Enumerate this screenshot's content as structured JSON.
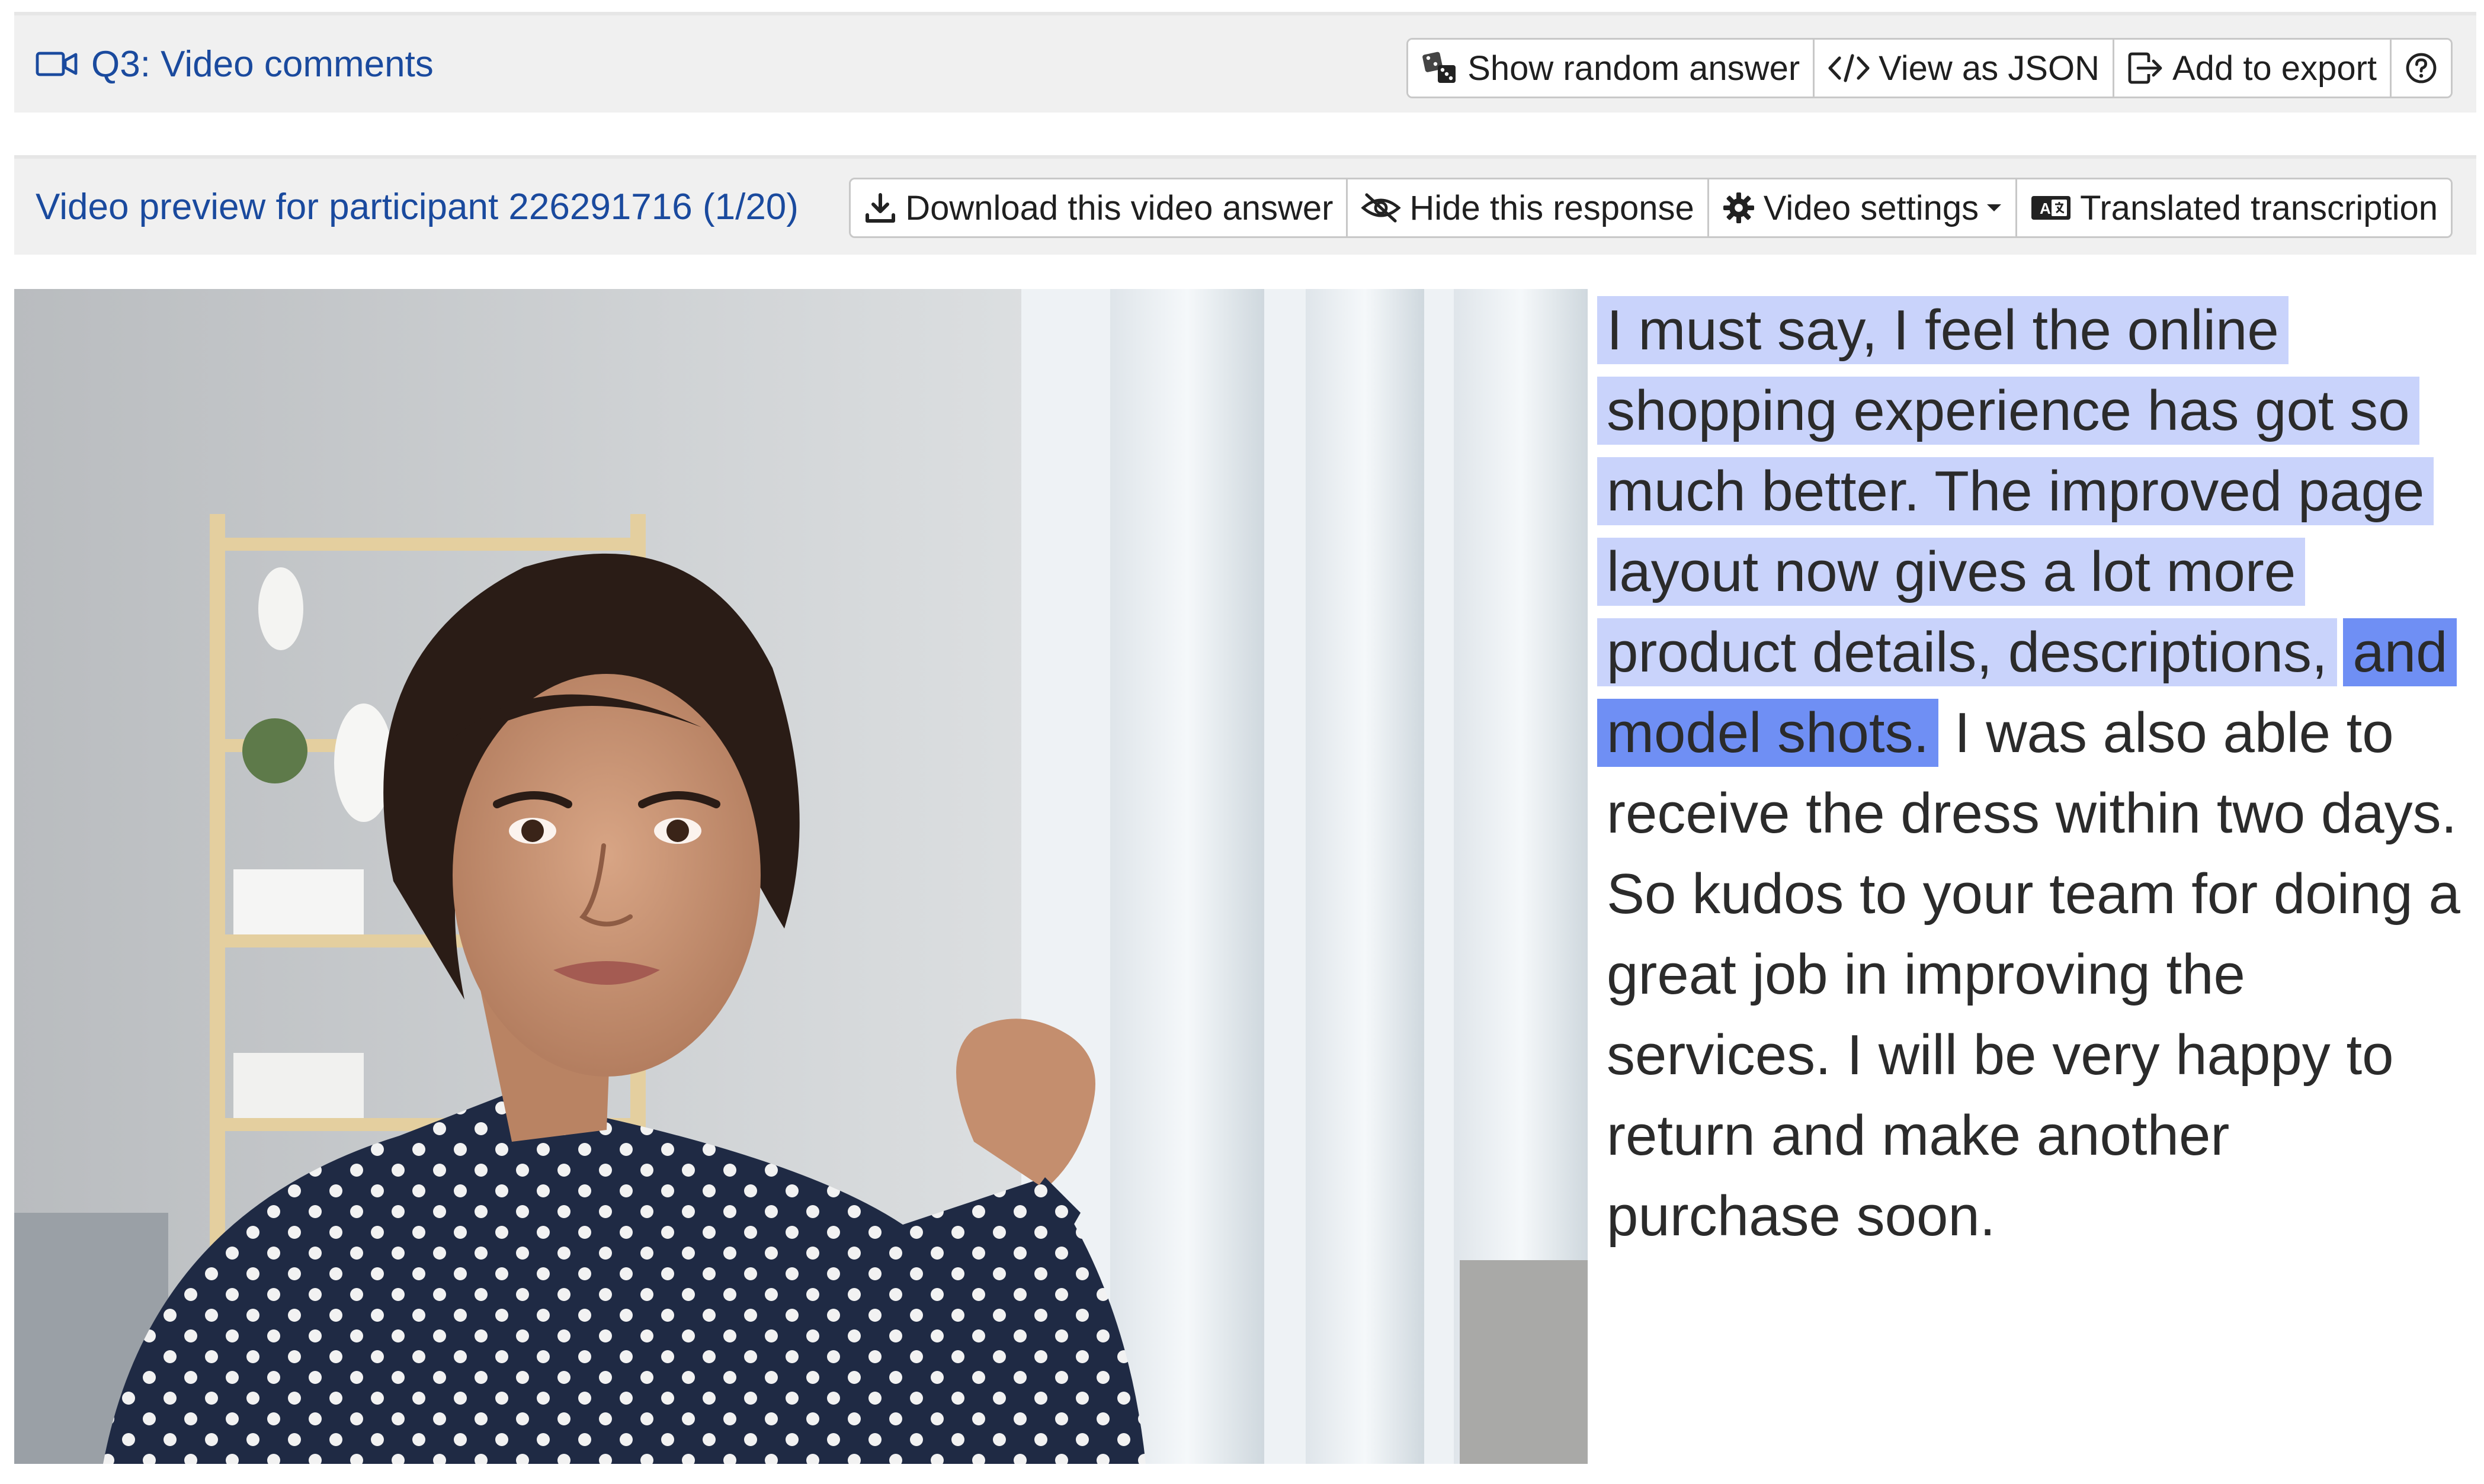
{
  "question": {
    "title": "Q3: Video comments",
    "buttons": {
      "random": "Show random answer",
      "json": "View as JSON",
      "export": "Add to export"
    }
  },
  "preview": {
    "title": "Video preview for participant 226291716 (1/20)",
    "buttons": {
      "download": "Download this video answer",
      "hide": "Hide this response",
      "settings": "Video settings",
      "translated": "Translated transcription"
    }
  },
  "transcript": {
    "highlighted_light": "I must say, I feel the online shopping experience has got so much better. The improved page layout now gives a lot more product details, descriptions,",
    "highlighted_strong": "and model shots.",
    "rest": " I was also able to receive the dress within two days. So kudos to your team for doing a great job in improving the services. I will be very happy to return and make another purchase soon."
  },
  "colors": {
    "link_blue": "#1a4a9e",
    "highlight_light": "#c9d3fb",
    "highlight_strong": "#6f8ff4",
    "bar_bg": "#f0f0f0"
  },
  "icons": [
    "video-camera-icon",
    "dice-icon",
    "code-icon",
    "export-icon",
    "help-icon",
    "download-icon",
    "eye-slash-icon",
    "gear-icon",
    "caret-down-icon",
    "translate-icon"
  ]
}
